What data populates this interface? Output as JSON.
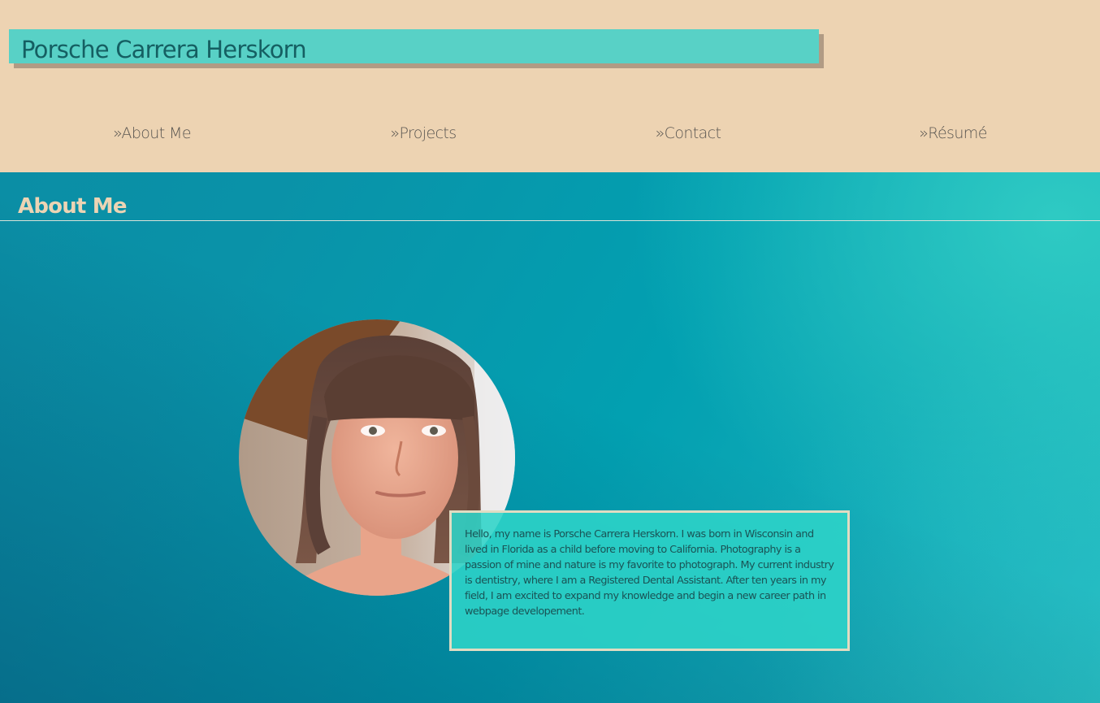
{
  "site": {
    "title": "Porsche Carrera Herskorn"
  },
  "nav": {
    "items": [
      {
        "label": "»About Me"
      },
      {
        "label": "»Projects"
      },
      {
        "label": "»Contact"
      },
      {
        "label": "»Résumé"
      }
    ]
  },
  "about": {
    "heading": "About Me",
    "bio": "Hello, my name is Porsche Carrera Herskorn. I was born in Wisconsin and lived in Florida as a child before moving to California. Photography is a passion of mine and nature is my favorite to photograph. My current industry is dentistry, where I am a Registered Dental Assistant. After ten years in my field, I am excited to expand my knowledge and begin a new career path in webpage developement."
  },
  "colors": {
    "header_bg": "#edd3b2",
    "title_bar": "#58d1c6",
    "title_text": "#155f62",
    "nav_text": "#5b5752",
    "section_heading": "#ecd4b4",
    "bio_box": "#2ed4c8",
    "bio_text": "#1a5355"
  }
}
